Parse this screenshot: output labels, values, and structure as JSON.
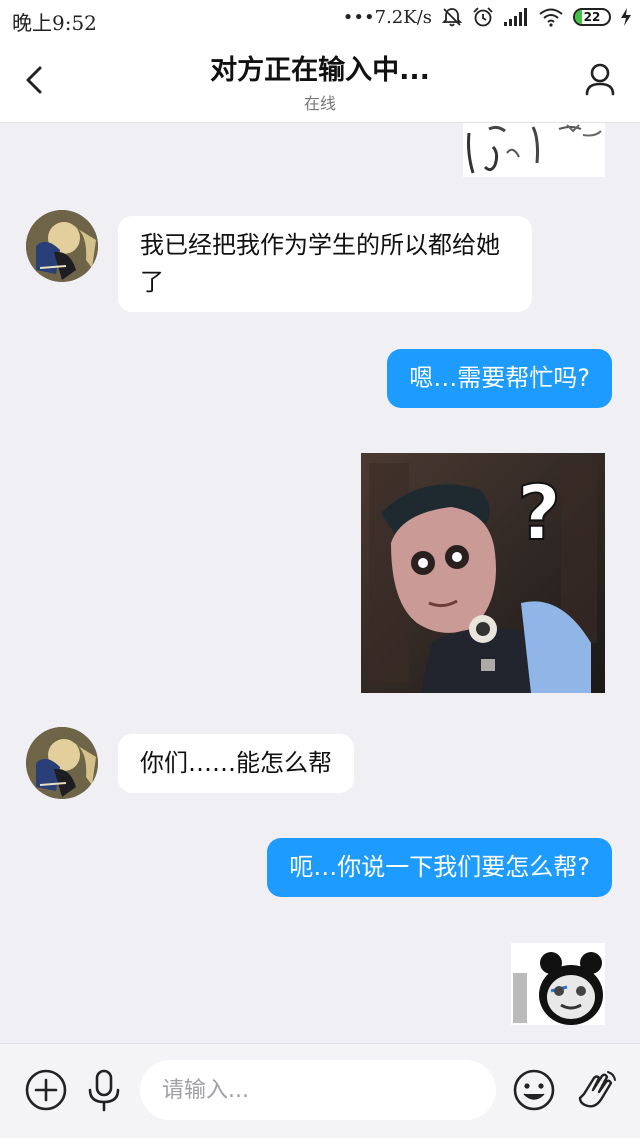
{
  "status_bar": {
    "time": "晚上9:52",
    "network_speed": "•••7.2K/s",
    "battery_level": "22",
    "battery_percent": 22,
    "battery_color": "#3fc43f",
    "icons": [
      "bell-muted-icon",
      "alarm-icon",
      "signal-icon",
      "wifi-icon",
      "battery-icon",
      "charging-icon"
    ]
  },
  "header": {
    "title": "对方正在输入中...",
    "subtitle": "在线",
    "back_icon": "chevron-left-icon",
    "profile_icon": "person-icon"
  },
  "messages": [
    {
      "type": "sticker",
      "direction": "out",
      "sticker": "rage-face-sticker-cropped"
    },
    {
      "type": "text",
      "direction": "in",
      "text": "我已经把我作为学生的所以都给她了"
    },
    {
      "type": "text",
      "direction": "out",
      "text": "嗯…需要帮忙吗?"
    },
    {
      "type": "sticker",
      "direction": "out",
      "sticker": "puppet-question-mark-sticker"
    },
    {
      "type": "text",
      "direction": "in",
      "text": "你们……能怎么帮"
    },
    {
      "type": "text",
      "direction": "out",
      "text": "呃…你说一下我们要怎么帮?"
    },
    {
      "type": "sticker",
      "direction": "out",
      "sticker": "panda-face-sticker"
    }
  ],
  "sticker_texts": {
    "question_mark": "?"
  },
  "composer": {
    "placeholder": "请输入...",
    "icons": [
      "plus-circle-icon",
      "microphone-icon",
      "emoji-icon",
      "wave-hand-icon"
    ]
  },
  "colors": {
    "outgoing_bubble": "#1e9bff",
    "incoming_bubble": "#ffffff",
    "chat_background": "#efeff4"
  }
}
